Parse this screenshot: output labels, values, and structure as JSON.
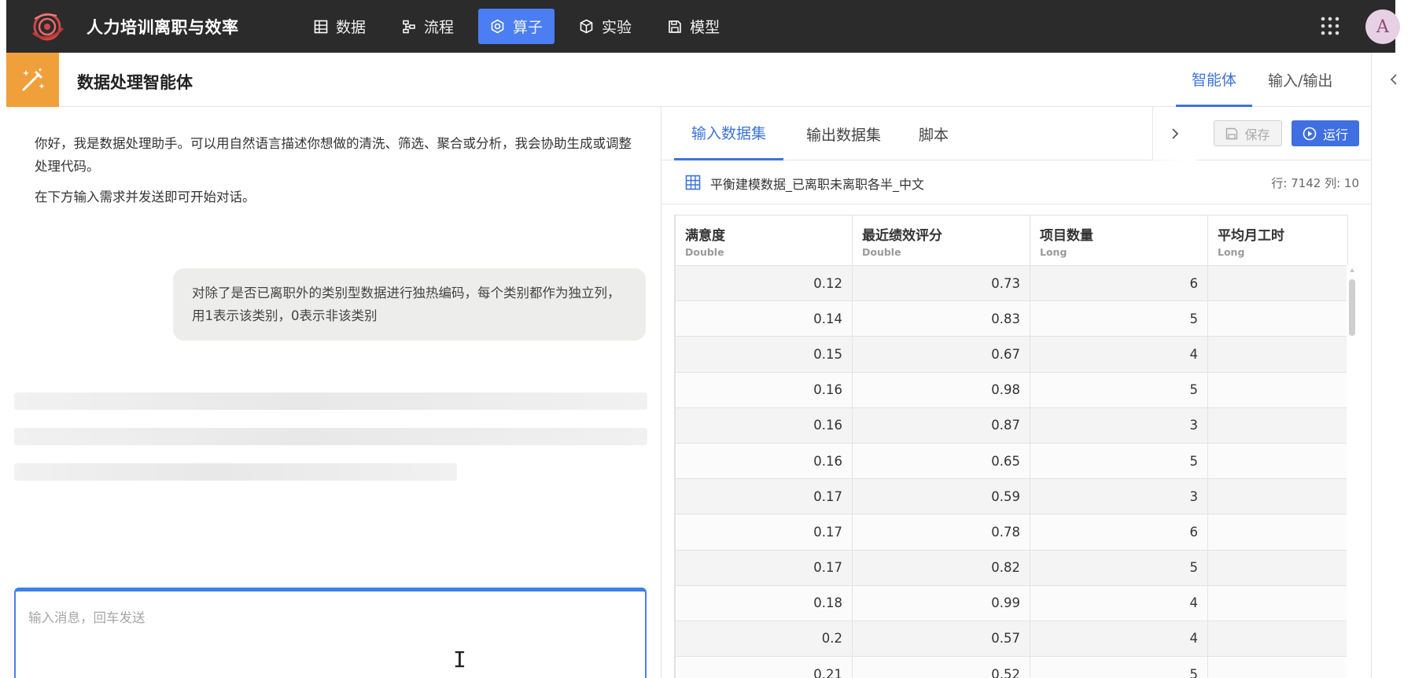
{
  "app": {
    "title": "人力培训离职与效率",
    "nav": [
      {
        "label": "数据",
        "icon": "table-icon"
      },
      {
        "label": "流程",
        "icon": "flow-icon"
      },
      {
        "label": "算子",
        "icon": "operator-icon",
        "active": true
      },
      {
        "label": "实验",
        "icon": "cube-icon"
      },
      {
        "label": "模型",
        "icon": "model-save-icon"
      }
    ],
    "avatar_initial": "A",
    "accent_color": "#4a7ef2"
  },
  "agent": {
    "title": "数据处理智能体",
    "right_tabs": [
      {
        "label": "智能体",
        "active": true
      },
      {
        "label": "输入/输出"
      }
    ]
  },
  "chat": {
    "welcome_line1": "你好，我是数据处理助手。可以用自然语言描述你想做的清洗、筛选、聚合或分析，我会协助生成或调整处理代码。",
    "welcome_line2": "在下方输入需求并发送即可开始对话。",
    "user_message": "对除了是否已离职外的类别型数据进行独热编码，每个类别都作为独立列，用1表示该类别，0表示非该类别",
    "input_placeholder": "输入消息，回车发送"
  },
  "data_panel": {
    "tabs": [
      {
        "label": "输入数据集",
        "active": true
      },
      {
        "label": "输出数据集"
      },
      {
        "label": "脚本"
      }
    ],
    "save_label": "保存",
    "run_label": "运行",
    "dataset_name": "平衡建模数据_已离职未离职各半_中文",
    "dataset_count": "行: 7142 列: 10",
    "columns": [
      {
        "name": "满意度",
        "type": "Double"
      },
      {
        "name": "最近绩效评分",
        "type": "Double"
      },
      {
        "name": "项目数量",
        "type": "Long"
      },
      {
        "name": "平均月工时",
        "type": "Long"
      }
    ],
    "rows": [
      [
        "0.12",
        "0.73",
        "6",
        ""
      ],
      [
        "0.14",
        "0.83",
        "5",
        ""
      ],
      [
        "0.15",
        "0.67",
        "4",
        ""
      ],
      [
        "0.16",
        "0.98",
        "5",
        ""
      ],
      [
        "0.16",
        "0.87",
        "3",
        ""
      ],
      [
        "0.16",
        "0.65",
        "5",
        ""
      ],
      [
        "0.17",
        "0.59",
        "3",
        ""
      ],
      [
        "0.17",
        "0.78",
        "6",
        ""
      ],
      [
        "0.17",
        "0.82",
        "5",
        ""
      ],
      [
        "0.18",
        "0.99",
        "4",
        ""
      ],
      [
        "0.2",
        "0.57",
        "4",
        ""
      ],
      [
        "0.21",
        "0.52",
        "5",
        ""
      ]
    ]
  }
}
